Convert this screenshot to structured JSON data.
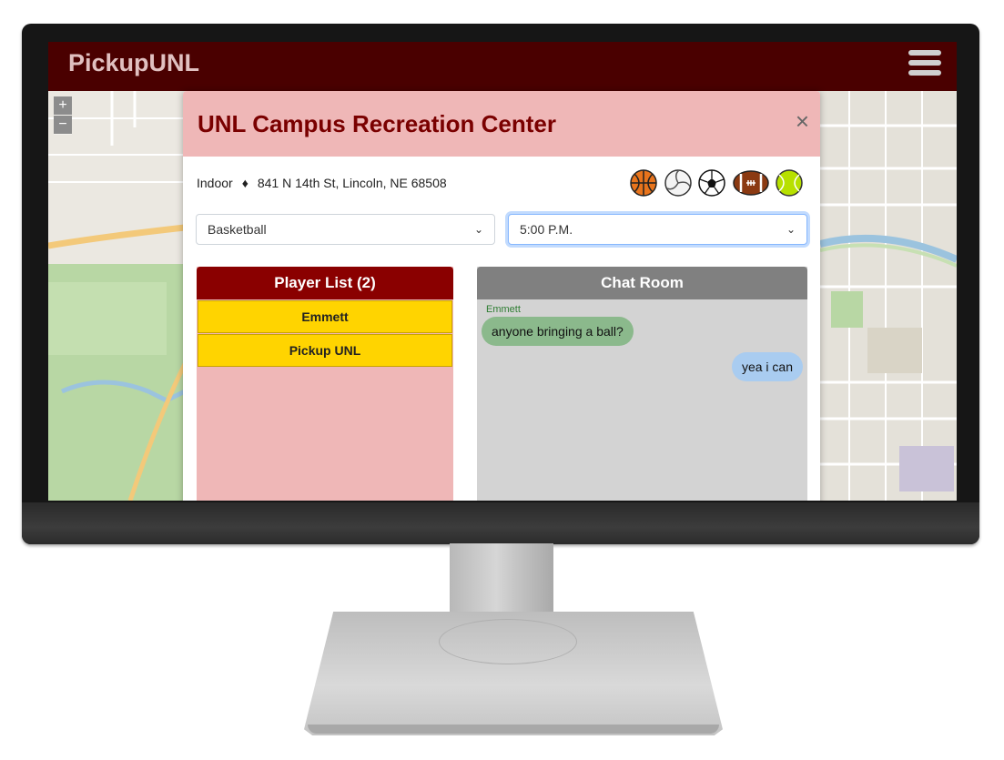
{
  "app": {
    "brand": "PickupUNL"
  },
  "map": {
    "zoom_in": "+",
    "zoom_out": "−"
  },
  "modal": {
    "title": "UNL Campus Recreation Center",
    "close_symbol": "×",
    "venue_type": "Indoor",
    "separator": "♦",
    "address": "841 N 14th St, Lincoln, NE 68508",
    "sports": [
      "basketball-icon",
      "volleyball-icon",
      "soccer-ball-icon",
      "football-icon",
      "tennis-ball-icon"
    ],
    "sport_select": {
      "value": "Basketball"
    },
    "time_select": {
      "value": "5:00 P.M."
    }
  },
  "players": {
    "title": "Player List (2)",
    "items": [
      {
        "name": "Emmett"
      },
      {
        "name": "Pickup UNL"
      }
    ]
  },
  "chat": {
    "title": "Chat Room",
    "messages": [
      {
        "sender": "Emmett",
        "text": "anyone bringing a ball?"
      },
      {
        "text": "yea i can"
      }
    ]
  },
  "colors": {
    "navbar": "#4a0000",
    "header_pink": "#efb7b7",
    "title_red": "#7a0000",
    "player_head": "#8a0000",
    "player_item": "#ffd400",
    "chat_head": "#808080",
    "bubble_in": "#8bb98c",
    "bubble_out": "#a9ccf0"
  }
}
